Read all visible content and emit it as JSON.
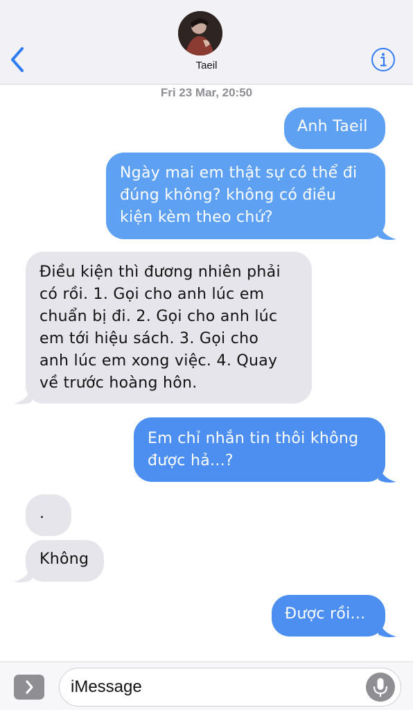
{
  "header": {
    "contact_name": "Taeil"
  },
  "conversation": {
    "timestamp": "Fri 23 Mar, 20:50",
    "messages": [
      {
        "from": "me",
        "text": "Anh Taeil"
      },
      {
        "from": "me",
        "lines": [
          "Ngày mai em thật sự có thể đi",
          "đúng không? không có điều",
          "kiện kèm theo chứ?"
        ]
      },
      {
        "from": "them",
        "lines": [
          "Điều kiện thì đương nhiên phải",
          "có rồi.  1. Gọi cho anh lúc em",
          "chuẩn bị đi.  2. Gọi cho anh lúc",
          "em tới hiệu sách.  3. Gọi cho",
          "anh lúc em xong việc.  4. Quay",
          "về trước hoàng hôn."
        ]
      },
      {
        "from": "me",
        "lines": [
          "Em chỉ nhắn tin thôi không",
          "được hả...?"
        ]
      },
      {
        "from": "them",
        "text": "."
      },
      {
        "from": "them",
        "text": "Không"
      },
      {
        "from": "me",
        "text": "Được rồi..."
      }
    ]
  },
  "input": {
    "placeholder": "iMessage"
  },
  "colors": {
    "outgoing_bubble": "#5ea0f2",
    "incoming_bubble": "#e6e5eb",
    "accent": "#2f7cf6"
  },
  "icons": {
    "back": "chevron-left-icon",
    "info": "info-circle-icon",
    "apps": "chevron-right-icon",
    "mic": "microphone-icon"
  }
}
